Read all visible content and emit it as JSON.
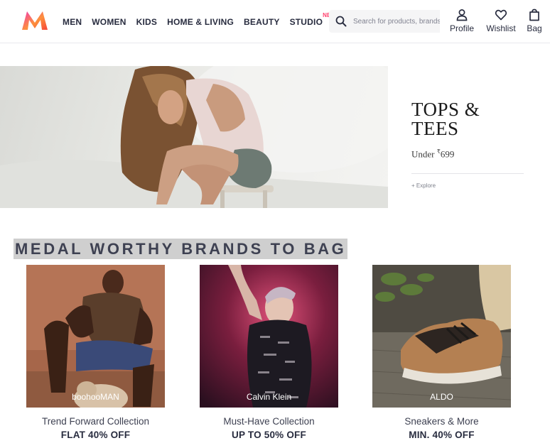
{
  "header": {
    "nav": [
      {
        "label": "MEN"
      },
      {
        "label": "WOMEN"
      },
      {
        "label": "KIDS"
      },
      {
        "label": "HOME & LIVING"
      },
      {
        "label": "BEAUTY"
      },
      {
        "label": "STUDIO",
        "badge": "NEW"
      }
    ],
    "search": {
      "placeholder": "Search for products, brands and more"
    },
    "actions": {
      "profile": "Profile",
      "wishlist": "Wishlist",
      "bag": "Bag"
    }
  },
  "banner": {
    "title": "TOPS & TEES",
    "subtitle_prefix": "Under ",
    "currency": "₹",
    "price": "699",
    "cta": "+ Explore"
  },
  "section": {
    "heading": "MEDAL WORTHY BRANDS TO BAG"
  },
  "cards": [
    {
      "brand": "boohooMAN",
      "title": "Trend Forward Collection",
      "offer": "FLAT 40% OFF"
    },
    {
      "brand": "Calvin Klein",
      "title": "Must-Have Collection",
      "offer": "UP TO 50% OFF"
    },
    {
      "brand": "ALDO",
      "title": "Sneakers & More",
      "offer": "MIN. 40% OFF"
    }
  ],
  "colors": {
    "accent": "#ff3f6c",
    "text": "#282c3f",
    "heading_bg": "#cfcfcf"
  }
}
